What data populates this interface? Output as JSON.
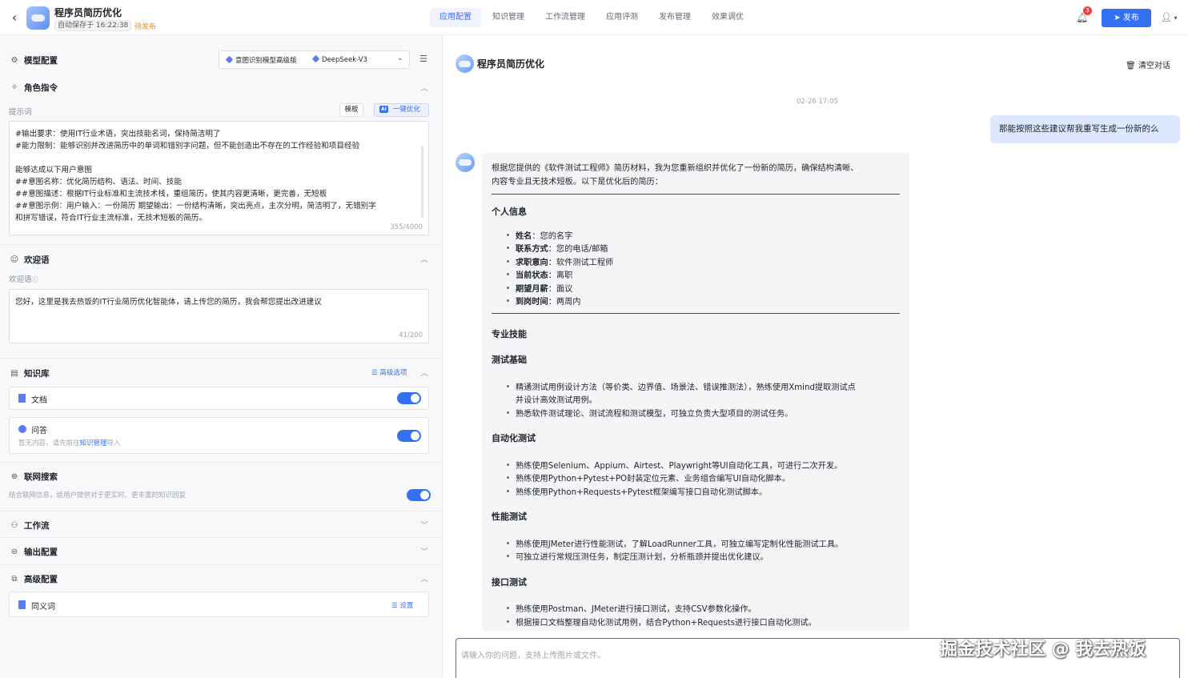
{
  "header": {
    "app_title": "程序员简历优化",
    "auto_saved": "自动保存于 16:22:38",
    "status": "待发布",
    "tabs": [
      {
        "label": "应用配置",
        "active": true
      },
      {
        "label": "知识管理",
        "active": false
      },
      {
        "label": "工作流管理",
        "active": false
      },
      {
        "label": "应用评测",
        "active": false
      },
      {
        "label": "发布管理",
        "active": false
      },
      {
        "label": "效果调优",
        "active": false
      }
    ],
    "notification_count": "3",
    "publish_label": "发布",
    "accent": "#3470f3"
  },
  "left": {
    "model": {
      "title": "模型配置",
      "intent_model": "意图识别模型高级版",
      "llm": "DeepSeek-V3"
    },
    "role": {
      "title": "角色指令",
      "prompt_label": "提示词",
      "template_btn": "模板",
      "optimize_badge": "AI",
      "optimize_btn": "一键优化",
      "prompt_lines": [
        "#输出要求：使用IT行业术语，突出技能名词，保持简洁明了",
        "#能力限制：能够识别并改进简历中的单词和错别字问题，但不能创造出不存在的工作经验和项目经验",
        "",
        "能够达成以下用户意图",
        "##意图名称：优化简历结构、语法、时间、技能",
        "##意图描述：根据IT行业标准和主流技术栈，重组简历，使其内容更清晰，更完善，无短板",
        "##意图示例：用户输入：一份简历      期望输出：一份结构清晰，突出亮点，主次分明，简洁明了，无错别字",
        "和拼写错误，符合IT行业主流标准，无技术短板的简历。"
      ],
      "count": "355/4000"
    },
    "welcome": {
      "title": "欢迎语",
      "label": "欢迎语",
      "text": "您好，这里是我去热饭的IT行业简历优化智能体，请上传您的简历，我会帮您提出改进建议",
      "count": "41/200"
    },
    "knowledge": {
      "title": "知识库",
      "advanced": "高级选项",
      "doc_label": "文档",
      "doc_enabled": true,
      "qa_label": "问答",
      "qa_hint_prefix": "暂无内容，请先前往",
      "qa_hint_link": "知识管理",
      "qa_hint_suffix": "导入",
      "qa_enabled": true
    },
    "web_search": {
      "title": "联网搜索",
      "desc": "结合联网信息，给用户提供对于更实时、更丰富的知识回复",
      "enabled": true
    },
    "workflow": {
      "title": "工作流"
    },
    "output": {
      "title": "输出配置"
    },
    "advanced": {
      "title": "高级配置",
      "synonym_label": "同义词",
      "settings": "设置"
    }
  },
  "chat": {
    "title": "程序员简历优化",
    "clear_label": "清空对话",
    "timestamp": "02-26 17:05",
    "user_message": "那能按照这些建议帮我重写生成一份新的么",
    "bot": {
      "intro_1": "根据您提供的《软件测试工程师》简历材料，我为您重新组织并优化了一份新的简历，确保结构清晰、",
      "intro_2": "内容专业且无技术短板。以下是优化后的简历：",
      "personal_title": "个人信息",
      "personal_items": [
        {
          "key": "姓名",
          "val": "：您的名字"
        },
        {
          "key": "联系方式",
          "val": "：您的电话/邮箱"
        },
        {
          "key": "求职意向",
          "val": "：软件测试工程师"
        },
        {
          "key": "当前状态",
          "val": "：离职"
        },
        {
          "key": "期望月薪",
          "val": "：面议"
        },
        {
          "key": "到岗时间",
          "val": "：两周内"
        }
      ],
      "skills_title": "专业技能",
      "basic_title": "测试基础",
      "basic_items": [
        "精通测试用例设计方法（等价类、边界值、场景法、错误推测法），熟练使用Xmind提取测试点",
        "并设计高效测试用例。",
        "熟悉软件测试理论、测试流程和测试模型，可独立负责大型项目的测试任务。"
      ],
      "auto_title": "自动化测试",
      "auto_items": [
        "熟练使用Selenium、Appium、Airtest、Playwright等UI自动化工具，可进行二次开发。",
        "熟练使用Python+Pytest+PO封装定位元素、业务组合编写UI自动化脚本。",
        "熟练使用Python+Requests+Pytest框架编写接口自动化测试脚本。"
      ],
      "perf_title": "性能测试",
      "perf_items": [
        "熟练使用JMeter进行性能测试，了解LoadRunner工具，可独立编写定制化性能测试工具。",
        "可独立进行常规压测任务，制定压测计划，分析瓶颈并提出优化建议。"
      ],
      "api_title": "接口测试",
      "api_items": [
        "熟练使用Postman、JMeter进行接口测试，支持CSV参数化操作。",
        "根据接口文档整理自动化测试用例，结合Python+Requests进行接口自动化测试。"
      ]
    },
    "input_placeholder": "请输入你的问题，支持上传图片或文件。"
  },
  "watermark": "掘金技术社区 @ 我去热饭"
}
